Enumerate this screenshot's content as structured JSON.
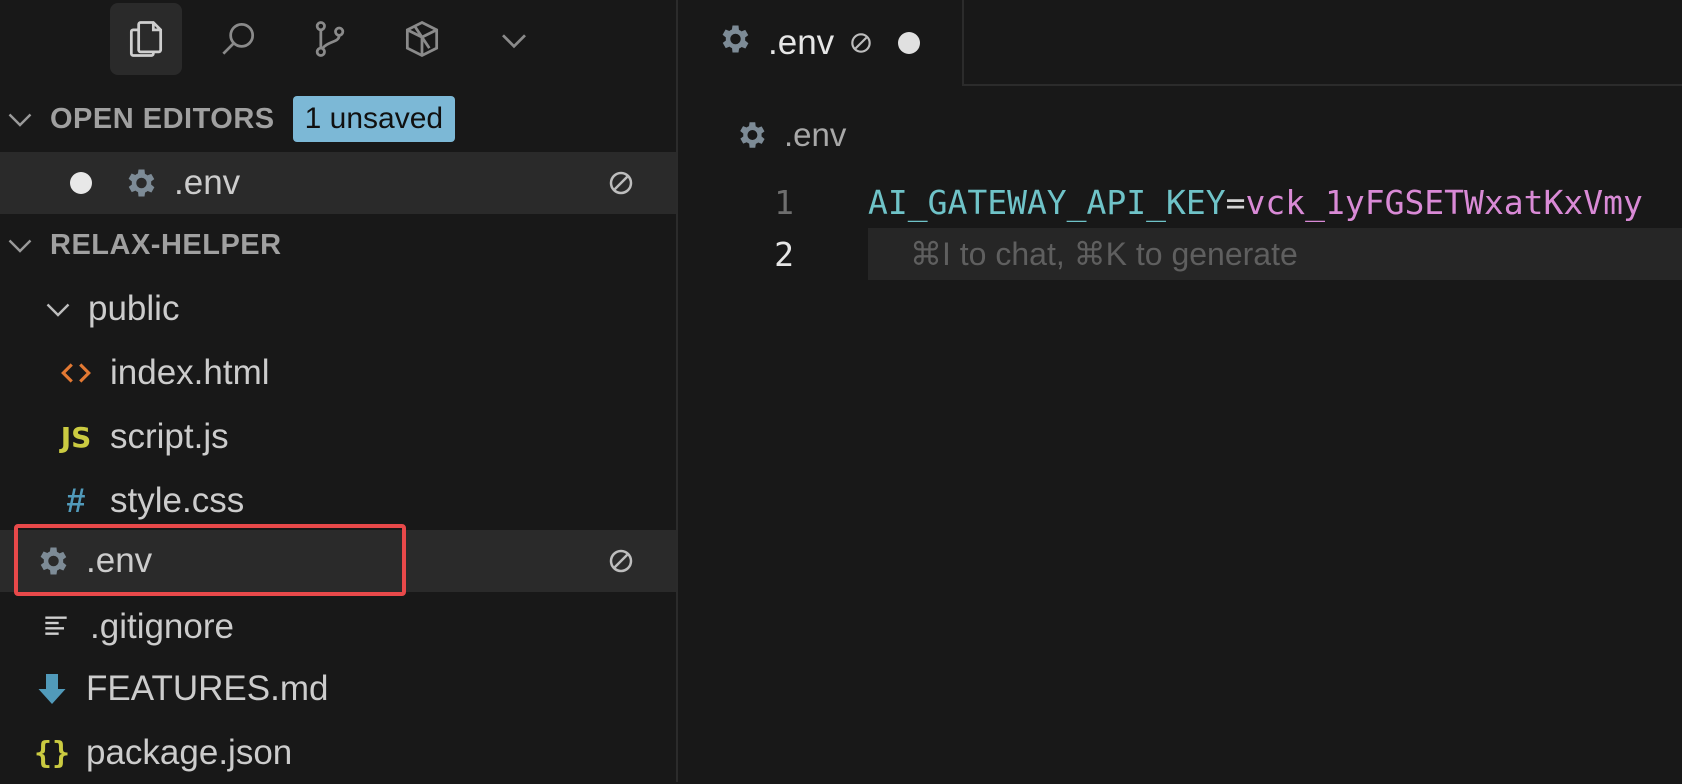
{
  "activity_bar": {
    "icons": [
      "explorer-icon",
      "search-icon",
      "source-control-icon",
      "extensions-icon",
      "chevron-down-icon"
    ]
  },
  "open_editors": {
    "header": "OPEN EDITORS",
    "badge": "1 unsaved",
    "items": [
      {
        "label": ".env",
        "dirty": true
      }
    ]
  },
  "explorer": {
    "header": "RELAX-HELPER",
    "items": [
      {
        "label": "public",
        "type": "folder",
        "expanded": true
      },
      {
        "label": "index.html",
        "type": "html"
      },
      {
        "label": "script.js",
        "type": "js"
      },
      {
        "label": "style.css",
        "type": "css"
      },
      {
        "label": ".env",
        "type": "env",
        "selected": true
      },
      {
        "label": ".gitignore",
        "type": "text"
      },
      {
        "label": "FEATURES.md",
        "type": "md"
      },
      {
        "label": "package.json",
        "type": "json"
      }
    ]
  },
  "tab": {
    "label": ".env",
    "dirty": true
  },
  "breadcrumb": {
    "label": ".env"
  },
  "editor": {
    "lines": [
      {
        "number": "1",
        "key": "AI_GATEWAY_API_KEY",
        "eq": "=",
        "value": "vck_1yFGSETWxatKxVmy"
      },
      {
        "number": "2",
        "hint": "⌘I to chat, ⌘K to generate"
      }
    ]
  },
  "colors": {
    "accent_badge": "#7cb8d6",
    "highlight_box": "#e8494a",
    "key": "#6fc3c8",
    "value": "#d98ad6"
  }
}
